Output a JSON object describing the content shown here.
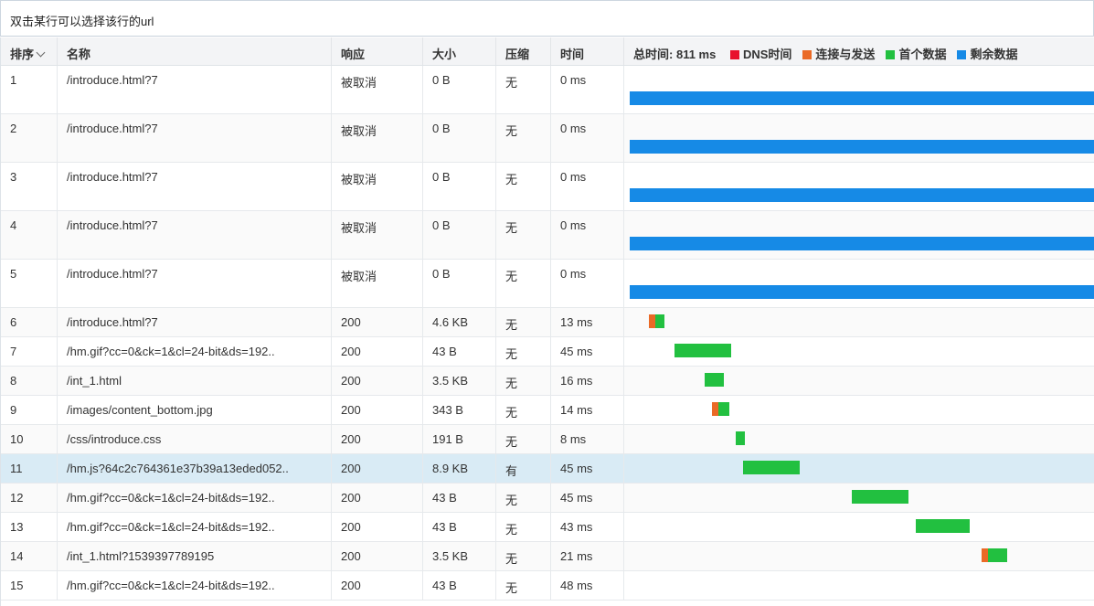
{
  "hint": "双击某行可以选择该行的url",
  "headers": {
    "rank": "排序",
    "name": "名称",
    "response": "响应",
    "size": "大小",
    "compress": "压缩",
    "time": "时间"
  },
  "timeline": {
    "total_label": "总时间:",
    "total_value": "811 ms",
    "total_ms": 811,
    "legend": [
      {
        "key": "dns",
        "label": "DNS时间",
        "color": "#e8112d"
      },
      {
        "key": "connect",
        "label": "连接与发送",
        "color": "#ea6a26"
      },
      {
        "key": "first",
        "label": "首个数据",
        "color": "#22c040"
      },
      {
        "key": "rest",
        "label": "剩余数据",
        "color": "#168ae6"
      }
    ]
  },
  "rows": [
    {
      "rank": "1",
      "name": "/introduce.html?7",
      "response": "被取消",
      "size": "0 B",
      "compress": "无",
      "time": "0 ms",
      "tall": true,
      "bars": [
        {
          "type": "rest",
          "start": 0.0,
          "end": 1.0
        }
      ]
    },
    {
      "rank": "2",
      "name": "/introduce.html?7",
      "response": "被取消",
      "size": "0 B",
      "compress": "无",
      "time": "0 ms",
      "tall": true,
      "bars": [
        {
          "type": "rest",
          "start": 0.0,
          "end": 1.0
        }
      ]
    },
    {
      "rank": "3",
      "name": "/introduce.html?7",
      "response": "被取消",
      "size": "0 B",
      "compress": "无",
      "time": "0 ms",
      "tall": true,
      "bars": [
        {
          "type": "rest",
          "start": 0.0,
          "end": 1.0
        }
      ]
    },
    {
      "rank": "4",
      "name": "/introduce.html?7",
      "response": "被取消",
      "size": "0 B",
      "compress": "无",
      "time": "0 ms",
      "tall": true,
      "bars": [
        {
          "type": "rest",
          "start": 0.0,
          "end": 1.0
        }
      ]
    },
    {
      "rank": "5",
      "name": "/introduce.html?7",
      "response": "被取消",
      "size": "0 B",
      "compress": "无",
      "time": "0 ms",
      "tall": true,
      "bars": [
        {
          "type": "rest",
          "start": 0.0,
          "end": 1.0
        }
      ]
    },
    {
      "rank": "6",
      "name": "/introduce.html?7",
      "response": "200",
      "size": "4.6 KB",
      "compress": "无",
      "time": "13 ms",
      "bars": [
        {
          "type": "connect",
          "start": 0.041,
          "end": 0.055
        },
        {
          "type": "first",
          "start": 0.055,
          "end": 0.075
        }
      ]
    },
    {
      "rank": "7",
      "name": "/hm.gif?cc=0&ck=1&cl=24-bit&ds=192..",
      "response": "200",
      "size": "43 B",
      "compress": "无",
      "time": "45 ms",
      "bars": [
        {
          "type": "first",
          "start": 0.096,
          "end": 0.219
        }
      ]
    },
    {
      "rank": "8",
      "name": "/int_1.html",
      "response": "200",
      "size": "3.5 KB",
      "compress": "无",
      "time": "16 ms",
      "bars": [
        {
          "type": "first",
          "start": 0.161,
          "end": 0.202
        }
      ]
    },
    {
      "rank": "9",
      "name": "/images/content_bottom.jpg",
      "response": "200",
      "size": "343 B",
      "compress": "无",
      "time": "14 ms",
      "bars": [
        {
          "type": "connect",
          "start": 0.177,
          "end": 0.19
        },
        {
          "type": "first",
          "start": 0.19,
          "end": 0.214
        }
      ]
    },
    {
      "rank": "10",
      "name": "/css/introduce.css",
      "response": "200",
      "size": "191 B",
      "compress": "无",
      "time": "8 ms",
      "bars": [
        {
          "type": "first",
          "start": 0.227,
          "end": 0.247
        }
      ]
    },
    {
      "rank": "11",
      "name": "/hm.js?64c2c764361e37b39a13eded052..",
      "response": "200",
      "size": "8.9 KB",
      "compress": "有",
      "time": "45 ms",
      "selected": true,
      "bars": [
        {
          "type": "first",
          "start": 0.243,
          "end": 0.365
        }
      ]
    },
    {
      "rank": "12",
      "name": "/hm.gif?cc=0&ck=1&cl=24-bit&ds=192..",
      "response": "200",
      "size": "43 B",
      "compress": "无",
      "time": "45 ms",
      "bars": [
        {
          "type": "first",
          "start": 0.478,
          "end": 0.6
        }
      ]
    },
    {
      "rank": "13",
      "name": "/hm.gif?cc=0&ck=1&cl=24-bit&ds=192..",
      "response": "200",
      "size": "43 B",
      "compress": "无",
      "time": "43 ms",
      "bars": [
        {
          "type": "first",
          "start": 0.614,
          "end": 0.73
        }
      ]
    },
    {
      "rank": "14",
      "name": "/int_1.html?1539397789195",
      "response": "200",
      "size": "3.5 KB",
      "compress": "无",
      "time": "21 ms",
      "bars": [
        {
          "type": "connect",
          "start": 0.757,
          "end": 0.77
        },
        {
          "type": "first",
          "start": 0.77,
          "end": 0.812
        }
      ]
    },
    {
      "rank": "15",
      "name": "/hm.gif?cc=0&ck=1&cl=24-bit&ds=192..",
      "response": "200",
      "size": "43 B",
      "compress": "无",
      "time": "48 ms",
      "bars": []
    }
  ]
}
